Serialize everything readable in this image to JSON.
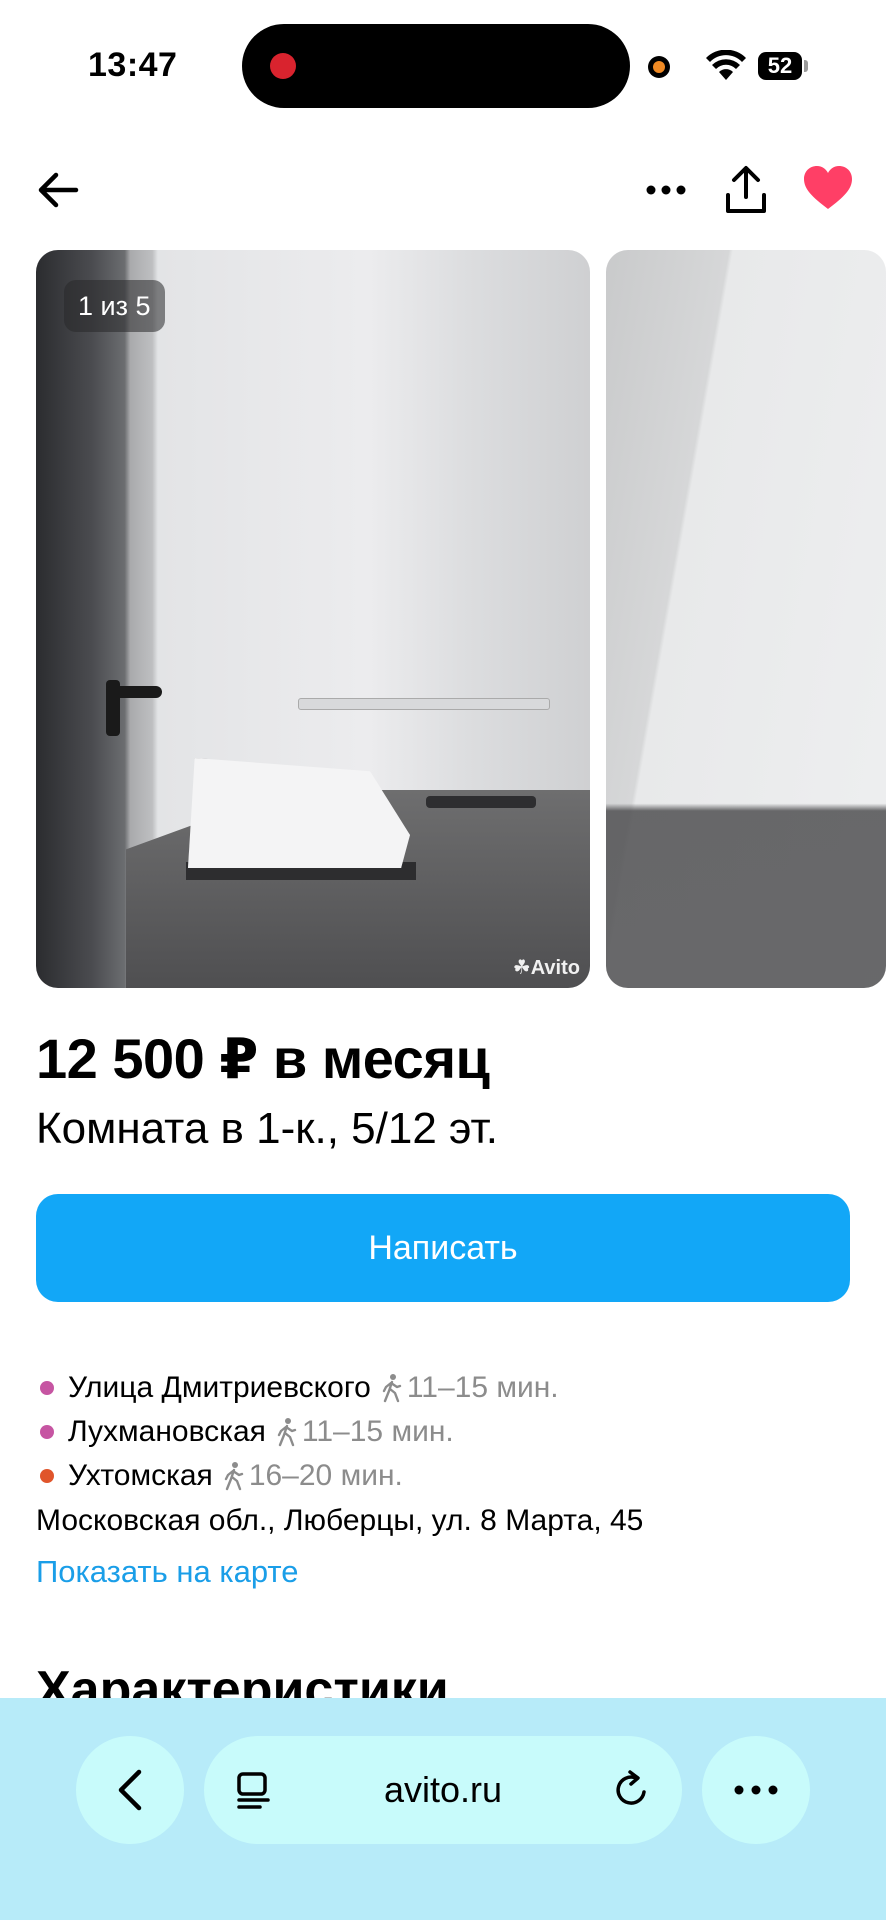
{
  "status_bar": {
    "time": "13:47",
    "battery": "52",
    "icons": [
      "recording-dot-icon",
      "camera-in-use-dot-icon",
      "wifi-icon",
      "battery-icon"
    ]
  },
  "toolbar": {
    "icons": [
      "back-arrow-icon",
      "more-dots-icon",
      "share-icon",
      "heart-icon"
    ],
    "favorite_color": "#ff3f66"
  },
  "gallery": {
    "counter": "1 из 5",
    "watermark": "Avito"
  },
  "listing": {
    "price": "12 500 ₽ в месяц",
    "subtitle": "Комната в 1-к., 5/12 эт.",
    "write_button": "Написать",
    "accent_color": "#12a7f7"
  },
  "metro": [
    {
      "name": "Улица Дмитриевского",
      "time": "11–15 мин.",
      "color": "#c655a2"
    },
    {
      "name": "Лухмановская",
      "time": "11–15 мин.",
      "color": "#c655a2"
    },
    {
      "name": "Ухтомская",
      "time": "16–20 мин.",
      "color": "#e0552b"
    }
  ],
  "address": "Московская обл., Люберцы, ул. 8 Марта, 45",
  "map_link": "Показать на карте",
  "section_title": "Характеристики",
  "browser": {
    "url": "avito.ru",
    "bar_color": "#b7ebf9"
  }
}
